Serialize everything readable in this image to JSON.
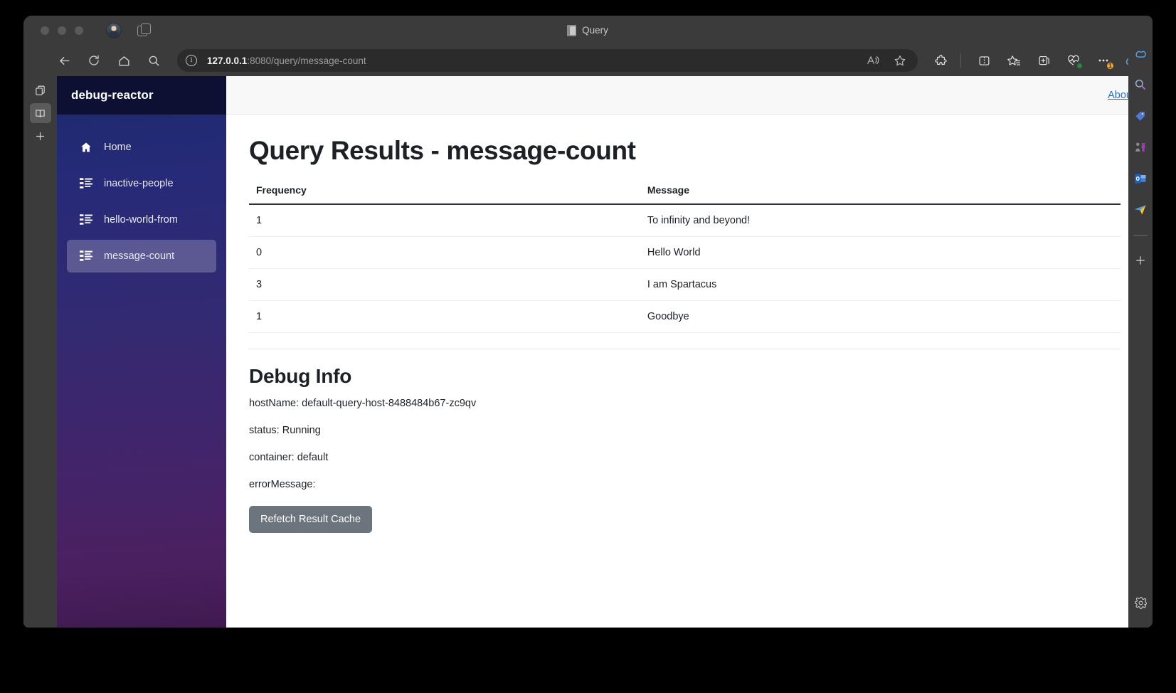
{
  "window": {
    "title": "Query",
    "title_icon": "document-icon"
  },
  "browser": {
    "url_host": "127.0.0.1",
    "url_path": ":8080/query/message-count",
    "nav_icons": [
      "back-icon",
      "refresh-icon",
      "home-icon",
      "search-icon"
    ],
    "omnibox_icons": [
      "read-aloud-icon",
      "favorite-star-icon"
    ],
    "toolbar_icons": [
      "extensions-icon",
      "split-screen-icon",
      "favorites-icon",
      "collections-icon",
      "browser-essentials-icon",
      "settings-more-icon",
      "copilot-icon"
    ],
    "left_strip_icons": [
      "tab-copy-icon",
      "reading-list-icon",
      "add-tab-icon"
    ],
    "right_sidebar_icons": [
      "copilot-icon",
      "search-discover-icon",
      "shopping-tag-icon",
      "games-icon",
      "outlook-icon",
      "send-message-icon",
      "add-sidebar-app-icon",
      "sidebar-settings-gear-icon"
    ]
  },
  "sidebar": {
    "brand": "debug-reactor",
    "items": [
      {
        "label": "Home",
        "icon": "home-icon",
        "active": false
      },
      {
        "label": "inactive-people",
        "icon": "list-icon",
        "active": false
      },
      {
        "label": "hello-world-from",
        "icon": "list-icon",
        "active": false
      },
      {
        "label": "message-count",
        "icon": "list-icon",
        "active": true
      }
    ]
  },
  "topbar": {
    "about_label": "About"
  },
  "main": {
    "page_title": "Query Results - message-count",
    "table": {
      "columns": [
        "Frequency",
        "Message"
      ],
      "rows": [
        {
          "frequency": "1",
          "message": "To infinity and beyond!"
        },
        {
          "frequency": "0",
          "message": "Hello World"
        },
        {
          "frequency": "3",
          "message": "I am Spartacus"
        },
        {
          "frequency": "1",
          "message": "Goodbye"
        }
      ]
    },
    "debug": {
      "title": "Debug Info",
      "hostName": "hostName: default-query-host-8488484b67-zc9qv",
      "status": "status: Running",
      "container": "container: default",
      "errorMessage": "errorMessage:",
      "refetch_button": "Refetch Result Cache"
    }
  },
  "colors": {
    "sidebar_top": "#1b2a6b",
    "sidebar_bottom": "#3f1a50",
    "brand_bg": "#0d1033",
    "link": "#2a6fc9",
    "button": "#6c757d",
    "chrome": "#3b3b3b"
  }
}
